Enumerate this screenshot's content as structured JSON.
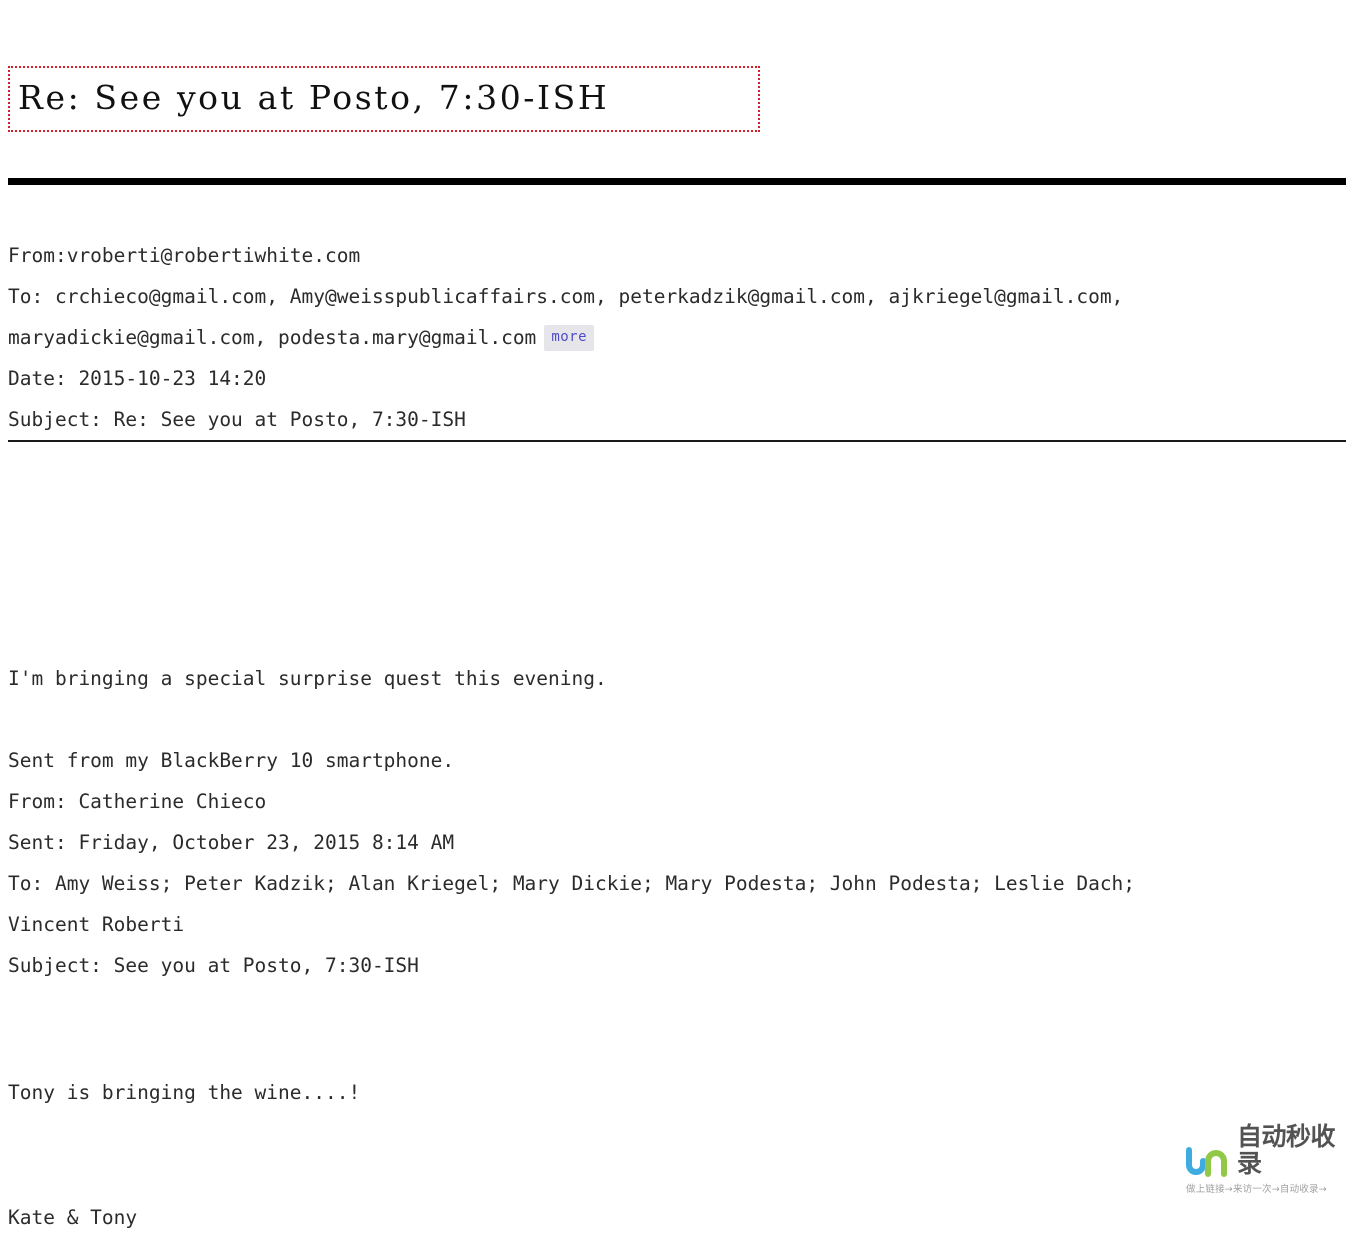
{
  "document": {
    "title": "Re: See you at Posto, 7:30-ISH"
  },
  "headers": {
    "from": "From:vroberti@robertiwhite.com",
    "to_line1": "To: crchieco@gmail.com, Amy@weisspublicaffairs.com, peterkadzik@gmail.com, ajkriegel@gmail.com,",
    "to_line2": "maryadickie@gmail.com, podesta.mary@gmail.com",
    "more_label": "more",
    "date": "Date: 2015-10-23 14:20",
    "subject": "Subject: Re: See you at Posto, 7:30-ISH"
  },
  "body": {
    "line_1": "I'm bringing a special surprise quest this evening.",
    "line_2": "Sent from my BlackBerry 10 smartphone.",
    "quoted_from": "From: Catherine Chieco",
    "quoted_sent": "Sent: Friday, October 23, 2015 8:14 AM",
    "quoted_to_1": "To: Amy Weiss; Peter Kadzik; Alan Kriegel; Mary Dickie; Mary Podesta; John Podesta; Leslie Dach;",
    "quoted_to_2": "Vincent Roberti",
    "quoted_subject": "Subject: See you at Posto, 7:30-ISH",
    "line_3": "Tony is bringing the wine....!",
    "signature": "Kate & Tony"
  },
  "watermark": {
    "brand_cn": "自动秒收录",
    "tagline": "做上链接→来访一次→自动收录→",
    "color_blue": "#35a8e0",
    "color_green": "#8cc63f"
  },
  "colors": {
    "title_border": "#d2202a",
    "rule": "#000000",
    "badge_bg": "#e6e6ea",
    "badge_text": "#4c4cc8",
    "text": "#2b2b2b"
  }
}
